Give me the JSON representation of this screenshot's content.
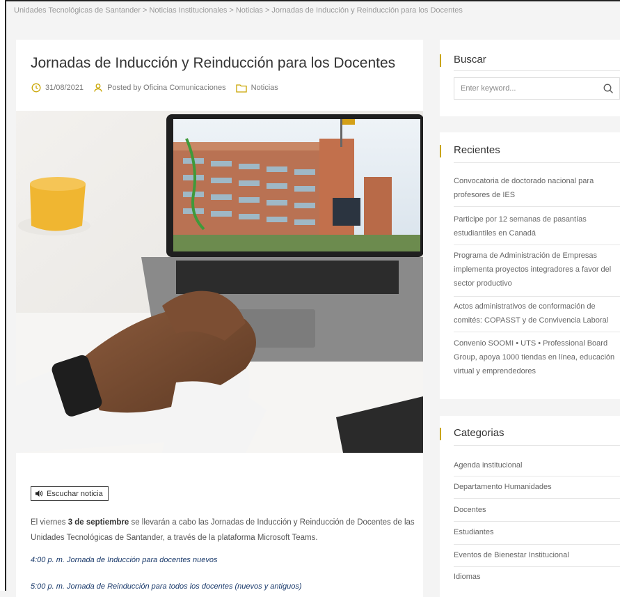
{
  "breadcrumb": {
    "items": [
      "Unidades Tecnológicas de Santander",
      "Noticias Institucionales",
      "Noticias",
      "Jornadas de Inducción y Reinducción para los Docentes"
    ],
    "separator": ">"
  },
  "article": {
    "title": "Jornadas de Inducción y Reinducción para los Docentes",
    "date": "31/08/2021",
    "author": "Posted by Oficina Comunicaciones",
    "category": "Noticias",
    "listen_label": "Escuchar noticia",
    "body_pre": "El viernes ",
    "body_bold": "3 de septiembre",
    "body_post": " se llevarán a cabo las Jornadas de Inducción y Reinducción de Docentes de las Unidades Tecnológicas de Santander, a través de la plataforma Microsoft Teams.",
    "schedule_1": "4:00 p. m. Jornada de Inducción para docentes nuevos",
    "schedule_2": "5:00 p. m. Jornada de Reinducción para todos los docentes (nuevos y antiguos)"
  },
  "sidebar": {
    "search": {
      "title": "Buscar",
      "placeholder": "Enter keyword..."
    },
    "recent": {
      "title": "Recientes",
      "items": [
        "Convocatoria de doctorado nacional para profesores de IES",
        "Participe por 12 semanas de pasantías estudiantiles en Canadá",
        "Programa de Administración de Empresas implementa proyectos integradores a favor del sector productivo",
        "Actos administrativos de conformación de comités: COPASST y de Convivencia Laboral",
        "Convenio SOOMI • UTS • Professional Board Group, apoya 1000 tiendas en línea, educación virtual y emprendedores"
      ]
    },
    "categories": {
      "title": "Categorias",
      "items": [
        "Agenda institucional",
        "Departamento Humanidades",
        "Docentes",
        "Estudiantes",
        "Eventos de Bienestar Institucional",
        "Idiomas"
      ]
    }
  },
  "colors": {
    "accent": "#c9a500",
    "link": "#1a3a6b"
  }
}
